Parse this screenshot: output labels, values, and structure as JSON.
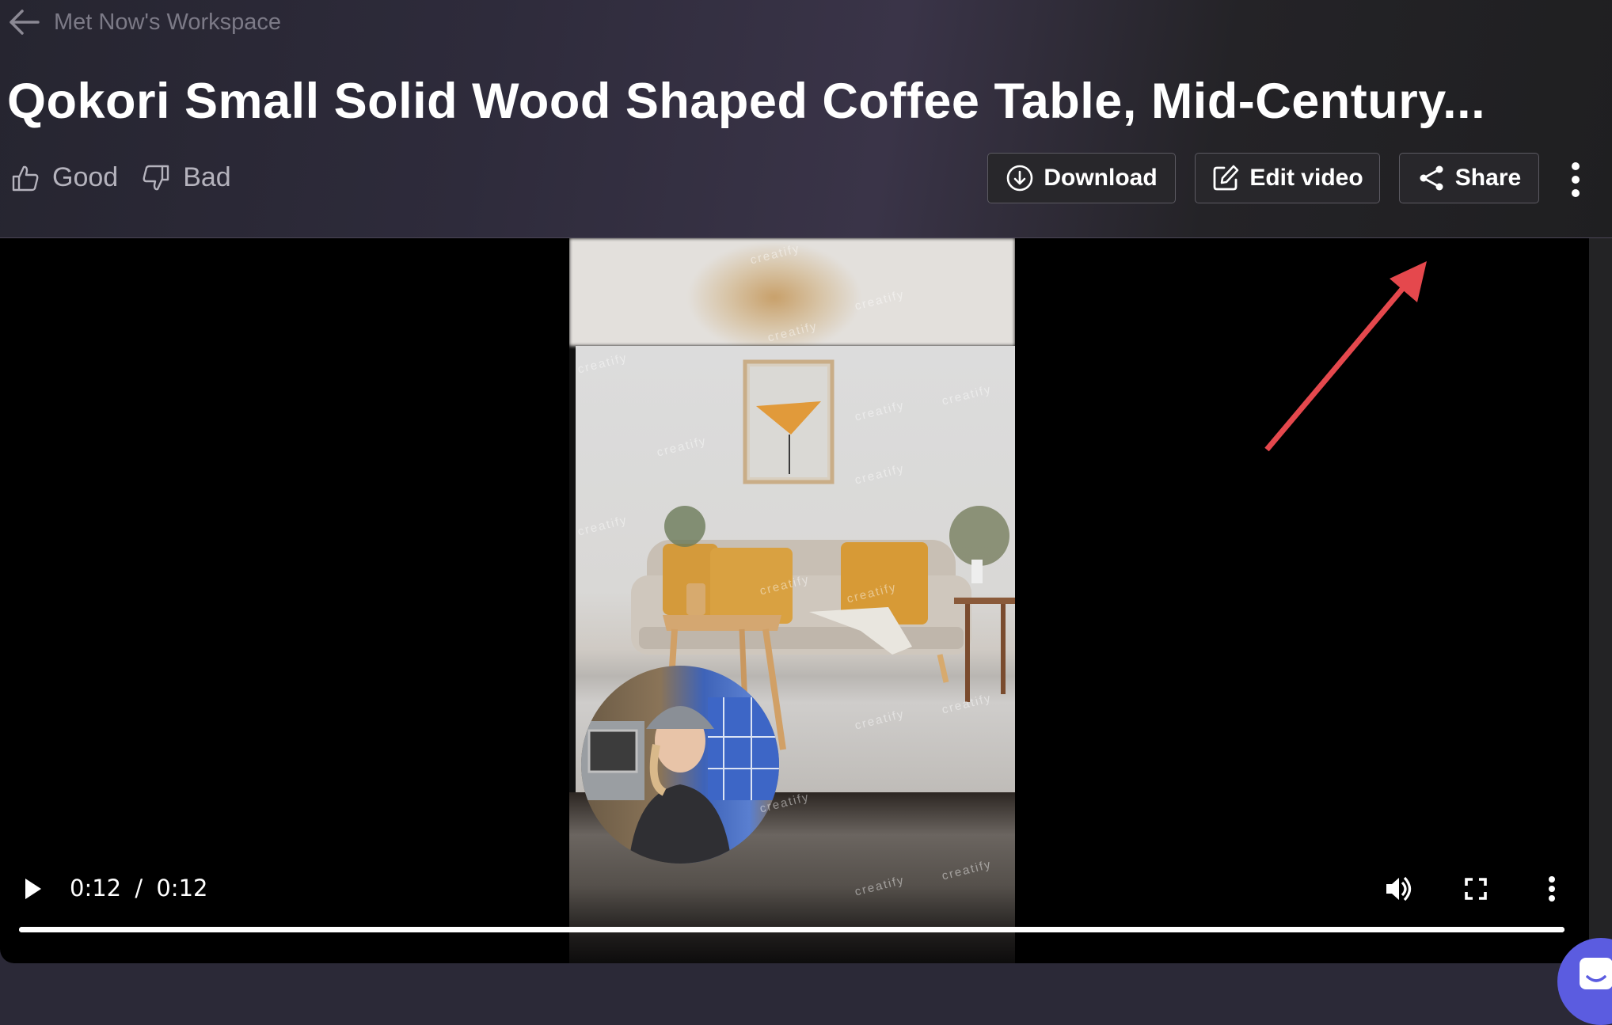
{
  "header": {
    "back_icon": "arrow-left-icon",
    "breadcrumb": "Met Now's Workspace",
    "title": "Qokori Small Solid Wood Shaped Coffee Table, Mid-Century...",
    "rating": {
      "good_label": "Good",
      "good_icon": "thumbs-up-icon",
      "bad_label": "Bad",
      "bad_icon": "thumbs-down-icon"
    },
    "actions": [
      {
        "label": "Download",
        "icon": "download-circle-icon"
      },
      {
        "label": "Edit video",
        "icon": "edit-icon"
      },
      {
        "label": "Share",
        "icon": "share-icon"
      }
    ],
    "more_icon": "kebab-menu-icon"
  },
  "player": {
    "current_time": "0:12",
    "separator": "/",
    "duration": "0:12",
    "progress_fraction": 1.0,
    "watermark": "creatify",
    "controls": {
      "play_icon": "play-icon",
      "volume_icon": "volume-icon",
      "fullscreen_icon": "fullscreen-icon",
      "more_icon": "kebab-menu-icon"
    }
  },
  "annotation": {
    "type": "arrow",
    "color": "#e5484d",
    "points_to": "Share"
  },
  "chat_widget": {
    "icon": "chat-bubble-icon",
    "color": "#5b5ce0"
  },
  "colors": {
    "accent": "#5b5ce0",
    "button_border": "#5c5a62",
    "annotation": "#e5484d"
  }
}
